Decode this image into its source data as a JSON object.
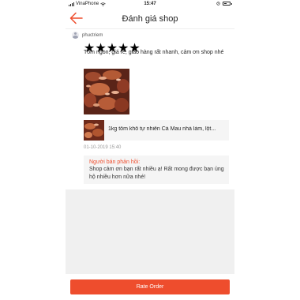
{
  "status_bar": {
    "carrier": "VinaPhone",
    "time": "15:47"
  },
  "header": {
    "back_icon": "back-arrow-icon",
    "title": "Đánh giá shop"
  },
  "review": {
    "username": "phuctriem",
    "rating": 5,
    "stars": "★★★★★",
    "comment": "Tôm ngon, giá rẻ, giao hàng rất nhanh, cảm ơn shop nhé",
    "product_name": "1kg tôm khô tự nhiên Cà Mau nhà làm, lột...",
    "datetime": "01-10-2019 15:40",
    "seller_reply": {
      "title": "Người bán phản hồi:",
      "text": "Shop cảm ơn bạn rất nhiều ạ! Rất mong được bạn ủng hộ nhiều hơn nữa nhé!"
    }
  },
  "footer": {
    "rate_button": "Rate Order"
  },
  "colors": {
    "accent": "#ee4d2d",
    "star": "#f2a516"
  }
}
